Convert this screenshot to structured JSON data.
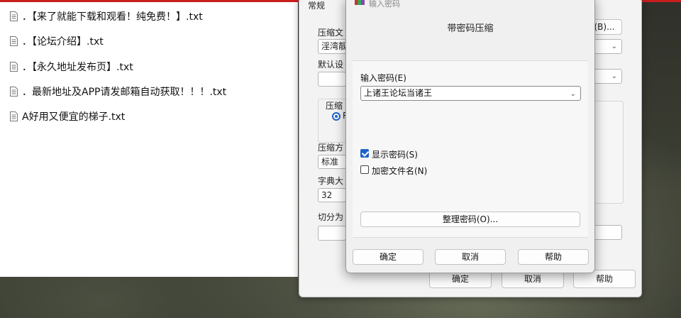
{
  "files": [
    "．【来了就能下载和观看！纯免费！】.txt",
    "．【论坛介绍】.txt",
    "．【永久地址发布页】.txt",
    "．最新地址及APP请发邮箱自动获取！！！.txt",
    "A好用又便宜的梯子.txt"
  ],
  "archive_dialog": {
    "tab_label": "常规",
    "archive_name_label": "压缩文",
    "archive_name_value": "淫湾靓",
    "browse_button": "(B)...",
    "default_profile_label": "默认设",
    "format_group_label": "压缩",
    "format_radio_label": "R",
    "method_label": "压缩方",
    "method_value": "标准",
    "dict_label": "字典大",
    "dict_value": "32",
    "split_label": "切分为",
    "ok_button": "确定",
    "cancel_button": "取消",
    "help_button": "帮助"
  },
  "password_dialog": {
    "window_title": "输入密码",
    "heading": "带密码压缩",
    "password_label": "输入密码(E)",
    "password_value": "上诸王论坛当诸王",
    "show_password_label": "显示密码(S)",
    "show_password_checked": true,
    "encrypt_names_label": "加密文件名(N)",
    "encrypt_names_checked": false,
    "organize_button": "整理密码(O)...",
    "ok_button": "确定",
    "cancel_button": "取消",
    "help_button": "帮助"
  }
}
